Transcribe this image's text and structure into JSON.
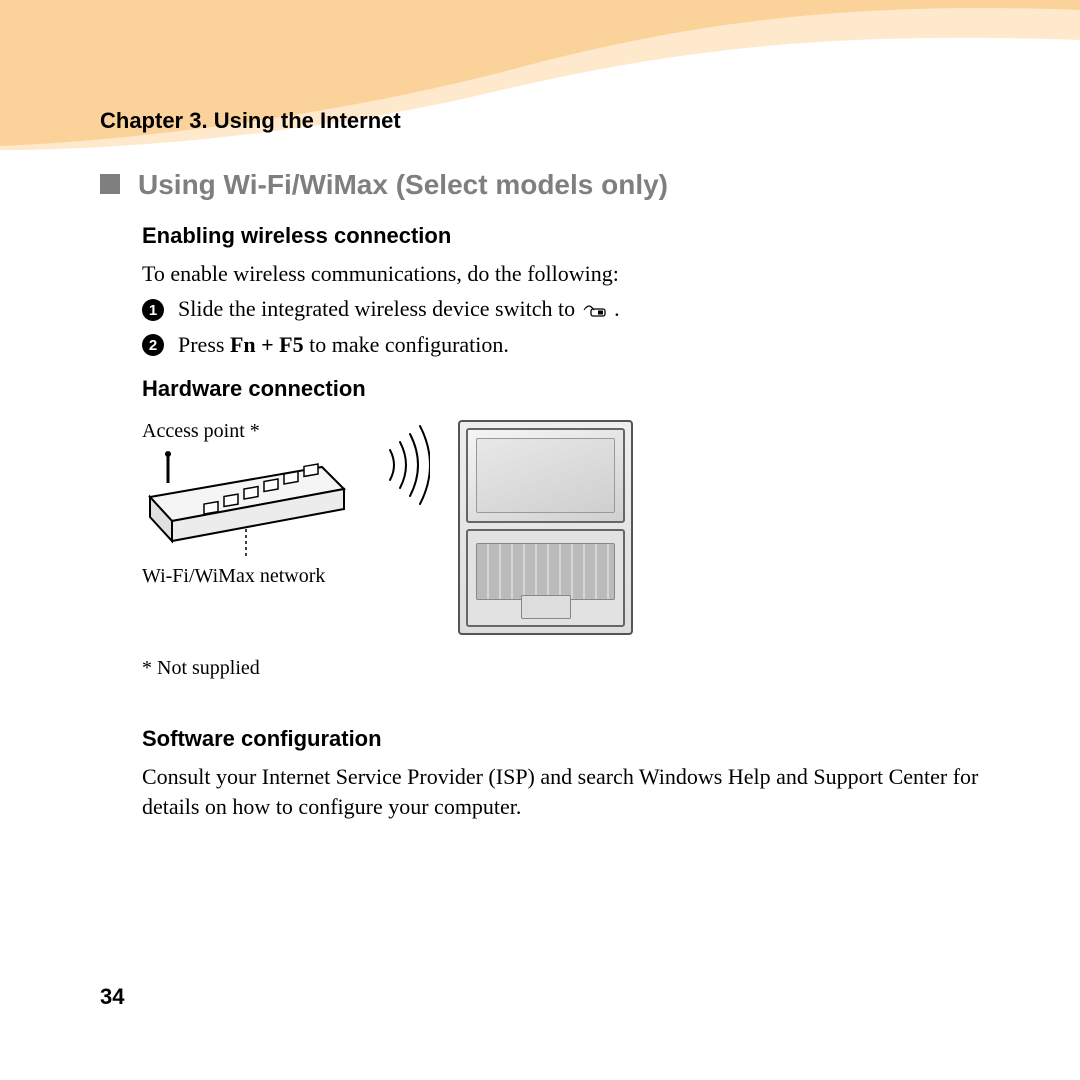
{
  "chapter": "Chapter 3. Using the Internet",
  "section_title": "Using Wi-Fi/WiMax (Select models only)",
  "enabling": {
    "heading": "Enabling wireless connection",
    "intro": "To enable wireless communications, do the following:",
    "step1_prefix": "Slide the integrated wireless device switch to ",
    "step1_suffix": ".",
    "step2_prefix": "Press ",
    "step2_key": "Fn + F5",
    "step2_suffix": " to make configuration."
  },
  "hardware": {
    "heading": "Hardware connection",
    "access_point": "Access point *",
    "network_label": "Wi-Fi/WiMax network",
    "footnote": "* Not supplied"
  },
  "software": {
    "heading": "Software configuration",
    "body": "Consult your Internet Service Provider (ISP) and search Windows Help and Support Center for details on how to configure your computer."
  },
  "page_number": "34"
}
